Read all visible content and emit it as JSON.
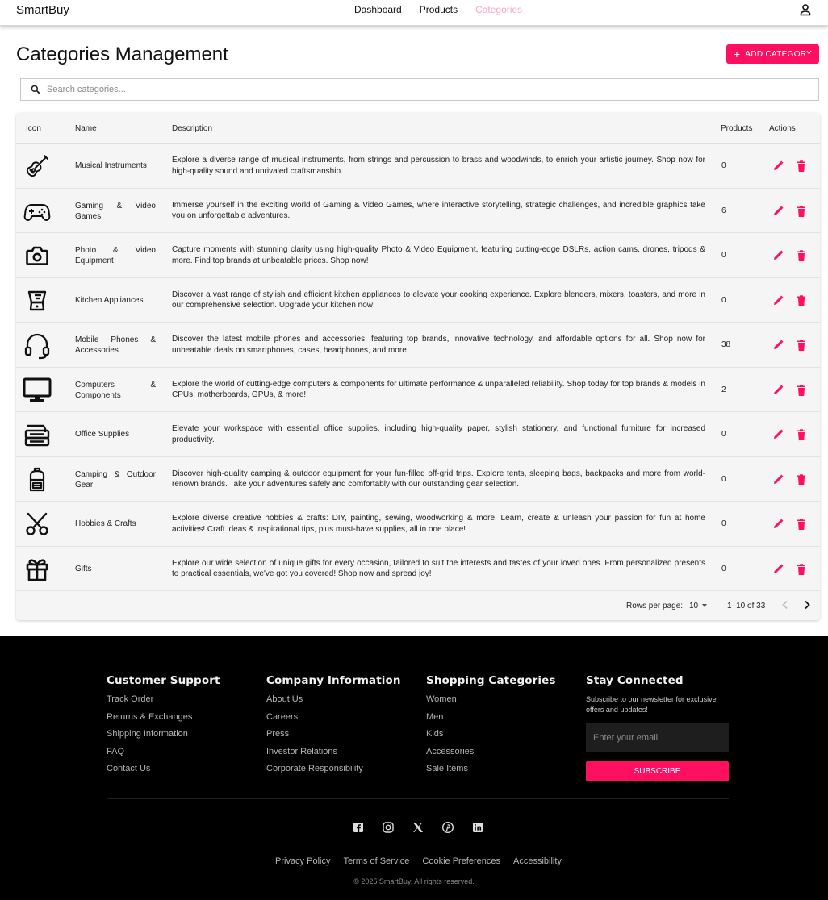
{
  "nav": {
    "brand": "SmartBuy",
    "links": [
      "Dashboard",
      "Products",
      "Categories"
    ],
    "active": "Categories",
    "user_icon": "user-icon"
  },
  "page": {
    "title": "Categories Management",
    "add_label": "ADD CATEGORY",
    "add_icon": "plus-icon",
    "search_placeholder": "Search categories...",
    "search_icon": "search-icon"
  },
  "table": {
    "headers": [
      "Icon",
      "Name",
      "Description",
      "Products",
      "Actions"
    ],
    "rows": [
      {
        "icon": "guitar-icon",
        "name": "Musical Instruments",
        "description": "Explore a diverse range of musical instruments, from strings and percussion to brass and woodwinds, to enrich your artistic journey. Shop now for high-quality sound and unrivaled craftsmanship.",
        "products": "0"
      },
      {
        "icon": "gamepad-icon",
        "name": "Gaming & Video Games",
        "description": "Immerse yourself in the exciting world of Gaming & Video Games, where interactive storytelling, strategic challenges, and incredible graphics take you on unforgettable adventures.",
        "products": "6"
      },
      {
        "icon": "camera-icon",
        "name": "Photo & Video Equipment",
        "description": "Capture moments with stunning clarity using high-quality Photo & Video Equipment, featuring cutting-edge DSLRs, action cams, drones, tripods & more. Find top brands at unbeatable prices. Shop now!",
        "products": "0"
      },
      {
        "icon": "blender-icon",
        "name": "Kitchen Appliances",
        "description": "Discover a vast range of stylish and efficient kitchen appliances to elevate your cooking experience. Explore blenders, mixers, toasters, and more in our comprehensive selection. Upgrade your kitchen now!",
        "products": "0"
      },
      {
        "icon": "headset-icon",
        "name": "Mobile Phones & Accessories",
        "description": "Discover the latest mobile phones and accessories, featuring top brands, innovative technology, and affordable options for all. Shop now for unbeatable deals on smartphones, cases, headphones, and more.",
        "products": "38"
      },
      {
        "icon": "monitor-icon",
        "name": "Computers & Components",
        "description": "Explore the world of cutting-edge computers & components for ultimate performance & unparalleled reliability. Shop today for top brands & models in CPUs, motherboards, GPUs, & more!",
        "products": "2"
      },
      {
        "icon": "office-tray-icon",
        "name": "Office Supplies",
        "description": "Elevate your workspace with essential office supplies, including high-quality paper, stylish stationery, and functional furniture for increased productivity.",
        "products": "0"
      },
      {
        "icon": "backpack-icon",
        "name": "Camping & Outdoor Gear",
        "description": "Discover high-quality camping & outdoor equipment for your fun-filled off-grid trips. Explore tents, sleeping bags, backpacks and more from world-renown brands. Take your adventures safely and comfortably with our outstanding gear selection.",
        "products": "0"
      },
      {
        "icon": "scissors-icon",
        "name": "Hobbies & Crafts",
        "description": "Explore diverse creative hobbies & crafts: DIY, painting, sewing, woodworking & more. Learn, create & unleash your passion for fun at home activities! Craft ideas & inspirational tips, plus must-have supplies, all in one place!",
        "products": "0"
      },
      {
        "icon": "gift-icon",
        "name": "Gifts",
        "description": "Explore our wide selection of unique gifts for every occasion, tailored to suit the interests and tastes of your loved ones. From personalized presents to practical essentials, we've got you covered! Shop now and spread joy!",
        "products": "0"
      }
    ],
    "action_icons": [
      "pencil-icon",
      "trash-icon"
    ]
  },
  "pagination": {
    "rows_label": "Rows per page:",
    "rows_value": "10",
    "range": "1–10 of 33"
  },
  "footer": {
    "columns": [
      {
        "title": "Customer Support",
        "links": [
          "Track Order",
          "Returns & Exchanges",
          "Shipping Information",
          "FAQ",
          "Contact Us"
        ]
      },
      {
        "title": "Company Information",
        "links": [
          "About Us",
          "Careers",
          "Press",
          "Investor Relations",
          "Corporate Responsibility"
        ]
      },
      {
        "title": "Shopping Categories",
        "links": [
          "Women",
          "Men",
          "Kids",
          "Accessories",
          "Sale Items"
        ]
      }
    ],
    "newsletter": {
      "title": "Stay Connected",
      "text": "Subscribe to our newsletter for exclusive offers and updates!",
      "placeholder": "Enter your email",
      "button": "SUBSCRIBE"
    },
    "socials": [
      "facebook-icon",
      "instagram-icon",
      "x-icon",
      "pinterest-icon",
      "linkedin-icon"
    ],
    "legal": [
      "Privacy Policy",
      "Terms of Service",
      "Cookie Preferences",
      "Accessibility"
    ],
    "copyright": "© 2025 SmartBuy. All rights reserved."
  },
  "colors": {
    "accent": "#ff0f5f",
    "active_nav": "#f7a8bd",
    "footer_bg": "#000000"
  }
}
